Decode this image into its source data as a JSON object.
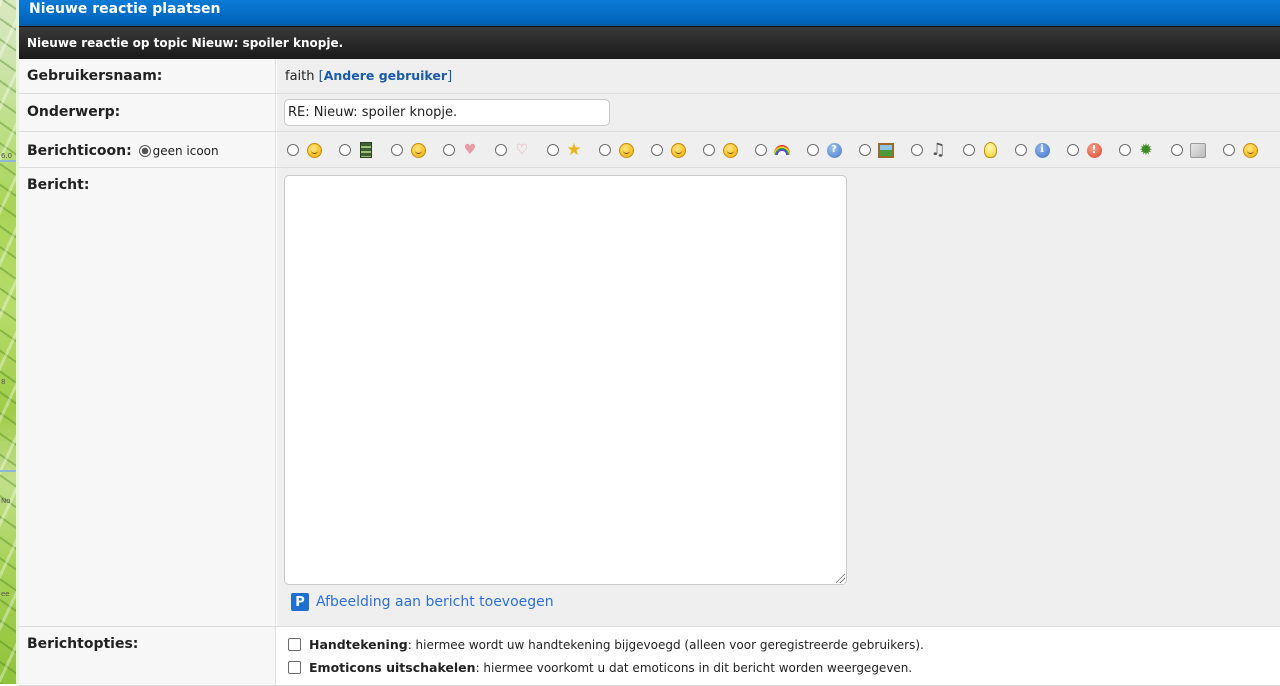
{
  "window": {
    "title": "Nieuwe reactie plaatsen",
    "subtitle": "Nieuwe reactie op topic Nieuw: spoiler knopje."
  },
  "map_labels": [
    "6.0",
    "8",
    "No",
    "ee"
  ],
  "form": {
    "username": {
      "label": "Gebruikersnaam:",
      "value": "faith",
      "bracket_open": "[",
      "link": "Andere gebruiker",
      "bracket_close": "]"
    },
    "subject": {
      "label": "Onderwerp:",
      "value": "RE: Nieuw: spoiler knopje."
    },
    "message_icon": {
      "label": "Berichticoon:",
      "none_option": "geen icoon",
      "selected": "geen icoon",
      "icons": [
        "laughing-smiley-icon",
        "film-icon",
        "tongue-smiley-icon",
        "thumbs-up-icon",
        "thumbs-down-icon",
        "star-icon",
        "wink-smiley-icon",
        "surprised-smiley-icon",
        "sad-smiley-icon",
        "rainbow-icon",
        "question-icon",
        "picture-icon",
        "music-note-icon",
        "lightbulb-icon",
        "info-icon",
        "exclamation-icon",
        "bug-icon",
        "block-icon",
        "grin-smiley-icon"
      ]
    },
    "message": {
      "label": "Bericht:",
      "value": "",
      "add_image_link": "Afbeelding aan bericht toevoegen"
    },
    "options": {
      "label": "Berichtopties:",
      "items": [
        {
          "title": "Handtekening",
          "desc": ": hiermee wordt uw handtekening bijgevoegd (alleen voor geregistreerde gebruikers).",
          "checked": false
        },
        {
          "title": "Emoticons uitschakelen",
          "desc": ": hiermee voorkomt u dat emoticons in dit bericht worden weergegeven.",
          "checked": false
        }
      ]
    }
  },
  "colors": {
    "header_blue": "#0a7bd6",
    "header_black": "#1a1a1a",
    "link_blue": "#1a5aa8",
    "accent_blue": "#2d6fd6"
  }
}
